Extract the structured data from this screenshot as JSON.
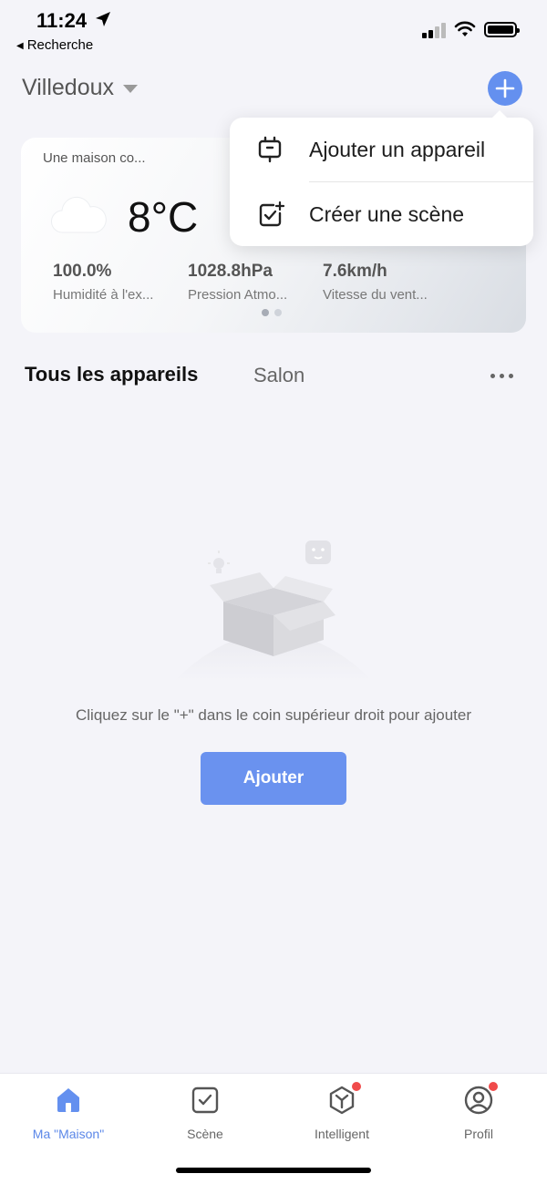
{
  "status_bar": {
    "time": "11:24",
    "back_label": "Recherche"
  },
  "header": {
    "home_name": "Villedoux",
    "add_icon": "plus-icon",
    "accent_color": "#6490ef"
  },
  "weather": {
    "title": "Une maison co...",
    "temperature": "8°C",
    "icon": "cloud-icon",
    "stats": [
      {
        "value": "100.0%",
        "label": "Humidité à l'ex..."
      },
      {
        "value": "1028.8hPa",
        "label": "Pression Atmo..."
      },
      {
        "value": "7.6km/h",
        "label": "Vitesse du vent..."
      }
    ]
  },
  "menu": {
    "items": [
      {
        "label": "Ajouter un appareil",
        "icon": "device-add-icon"
      },
      {
        "label": "Créer une scène",
        "icon": "scene-add-icon"
      }
    ]
  },
  "tabs": {
    "all": "Tous les appareils",
    "salon": "Salon"
  },
  "empty_state": {
    "message": "Cliquez sur le \"+\" dans le coin supérieur droit pour ajouter",
    "button_label": "Ajouter"
  },
  "bottom_nav": {
    "items": [
      {
        "label": "Ma \"Maison\"",
        "icon": "home-icon",
        "active": true
      },
      {
        "label": "Scène",
        "icon": "scene-icon",
        "active": false
      },
      {
        "label": "Intelligent",
        "icon": "smart-icon",
        "active": false,
        "badge": true
      },
      {
        "label": "Profil",
        "icon": "profile-icon",
        "active": false,
        "badge": true
      }
    ]
  }
}
